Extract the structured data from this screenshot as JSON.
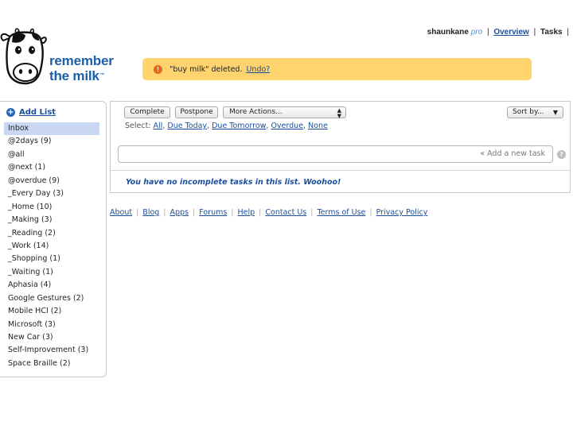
{
  "logo": {
    "line1": "remember",
    "line2": "the milk",
    "tm": "™"
  },
  "topnav": {
    "user": "shaunkane",
    "pro": "pro",
    "sep": "|",
    "links": [
      "Overview",
      "Tasks"
    ]
  },
  "status": {
    "icon": "!",
    "message": "\"buy milk\" deleted.",
    "undo": "Undo?",
    "color": "#ffd36e"
  },
  "sidebar": {
    "add_list": "Add List",
    "add_icon": "+",
    "selected": "Inbox",
    "lists": [
      "Inbox",
      "@2days (9)",
      "@all",
      "@next (1)",
      "@overdue (9)",
      "_Every Day (3)",
      "_Home (10)",
      "_Making (3)",
      "_Reading (2)",
      "_Work (14)",
      "_Shopping (1)",
      "_Waiting (1)",
      "Aphasia (4)",
      "Google Gestures (2)",
      "Mobile HCI (2)",
      "Microsoft (3)",
      "New Car (3)",
      "Self-Improvement (3)",
      "Space Braille (2)"
    ]
  },
  "toolbar": {
    "complete": "Complete",
    "postpone": "Postpone",
    "more_actions": "More Actions...",
    "sort_by": "Sort by..."
  },
  "select": {
    "label": "Select:",
    "options": [
      "All",
      "Due Today",
      "Due Tomorrow",
      "Overdue",
      "None"
    ]
  },
  "add_task": {
    "placeholder": "« Add a new task",
    "help": "?"
  },
  "empty_message": "You have no incomplete tasks in this list. Woohoo!",
  "footer": {
    "links": [
      "About",
      "Blog",
      "Apps",
      "Forums",
      "Help",
      "Contact Us",
      "Terms of Use",
      "Privacy Policy"
    ]
  }
}
